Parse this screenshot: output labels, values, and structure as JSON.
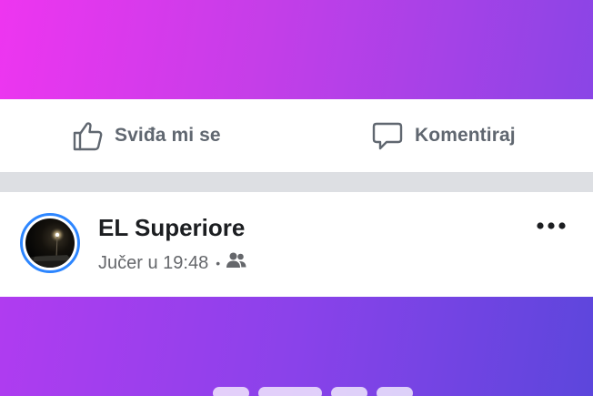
{
  "colors": {
    "gradient_top_start": "#ee35f0",
    "gradient_top_end": "#8a45e6",
    "gradient_bottom_start": "#b03cf0",
    "gradient_bottom_end": "#5c46dc",
    "action_text": "#606770",
    "name_text": "#1c1e21",
    "meta_text": "#65676b",
    "avatar_ring": "#2d86ff"
  },
  "actions": {
    "like": {
      "label": "Sviđa mi se",
      "icon": "thumbs-up-icon"
    },
    "comment": {
      "label": "Komentiraj",
      "icon": "comment-bubble-icon"
    }
  },
  "post": {
    "author": "EL Superiore",
    "timestamp": "Jučer u 19:48",
    "separator": "•",
    "audience_icon": "friends-icon",
    "more_icon": "more-horizontal-icon"
  }
}
